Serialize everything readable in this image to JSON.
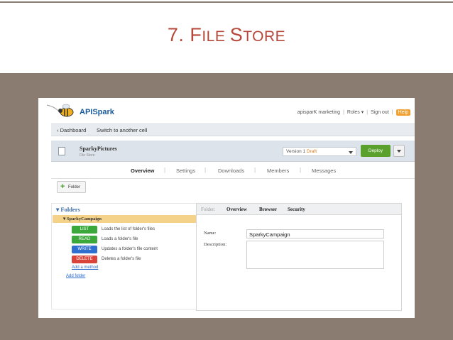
{
  "slide": {
    "title_number": "7. ",
    "title_big_f": "F",
    "title_rest_1": "ILE ",
    "title_big_s": "S",
    "title_rest_2": "TORE"
  },
  "app": {
    "logo_text": "APISpark",
    "topnav": {
      "account": "apisparK marketing",
      "roles": "Roles ▾",
      "signout": "Sign out",
      "help": "Help"
    },
    "breadcrumb": {
      "back": "‹ Dashboard",
      "switch": "Switch to another cell"
    },
    "cell": {
      "name": "SparkyPictures",
      "type": "File Store",
      "version_prefix": "Version 1 ",
      "version_status": "Draft",
      "deploy_label": "Deploy"
    },
    "tabs": [
      "Overview",
      "Settings",
      "Downloads",
      "Members",
      "Messages"
    ],
    "active_tab": "Overview",
    "add_folder_button": "Folder",
    "tree": {
      "root": "Folders",
      "selected": "SparkyCampaign",
      "methods": [
        {
          "verb": "LIST",
          "desc": "Loads the list of folder's files",
          "color": "#3aa83a"
        },
        {
          "verb": "READ",
          "desc": "Loads a folder's file",
          "color": "#3aa83a"
        },
        {
          "verb": "WRITE",
          "desc": "Updates a folder's file content",
          "color": "#2f6fd0"
        },
        {
          "verb": "DELETE",
          "desc": "Deletes a folder's file",
          "color": "#d9433a"
        }
      ],
      "add_method": "Add a method",
      "add_folder": "Add folder"
    },
    "detail": {
      "context_label": "Folder:",
      "tabs": [
        "Overview",
        "Browser",
        "Security"
      ],
      "name_label": "Name:",
      "name_value": "SparkyCampaign",
      "description_label": "Description:",
      "description_value": ""
    }
  }
}
